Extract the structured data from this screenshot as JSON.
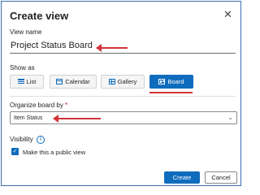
{
  "dialog": {
    "title": "Create view",
    "close_icon": "close-icon",
    "close_glyph": "✕"
  },
  "view_name": {
    "label": "View name",
    "value": "Project Status Board"
  },
  "show_as": {
    "label": "Show as",
    "options": [
      {
        "label": "List",
        "icon": "list-icon",
        "selected": false
      },
      {
        "label": "Calendar",
        "icon": "calendar-icon",
        "selected": false
      },
      {
        "label": "Gallery",
        "icon": "gallery-icon",
        "selected": false
      },
      {
        "label": "Board",
        "icon": "board-icon",
        "selected": true
      }
    ]
  },
  "organize": {
    "label": "Organize board by",
    "required_mark": "*",
    "selected": "Item Status",
    "chevron_glyph": "⌄"
  },
  "visibility": {
    "label": "Visibility",
    "info_glyph": "i",
    "checkbox_label": "Make this a public view",
    "checked": true,
    "check_glyph": "✓"
  },
  "actions": {
    "create_label": "Create",
    "cancel_label": "Cancel"
  },
  "colors": {
    "accent": "#0f6cbd",
    "annotation": "#d13438",
    "frame_border": "#3a6fb0"
  }
}
